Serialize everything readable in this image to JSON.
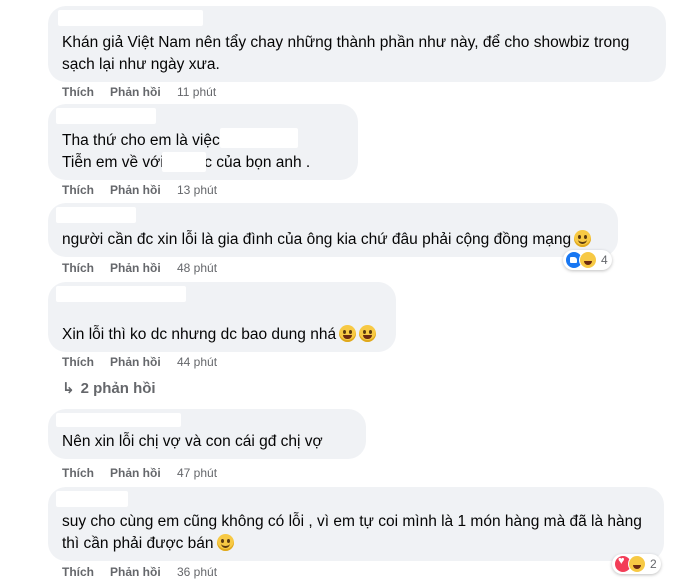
{
  "actions": {
    "like": "Thích",
    "reply": "Phản hồi"
  },
  "comments": [
    {
      "lines": [
        "Khán giả Việt Nam nên tẩy chay những thành phần như này, để cho showbiz trong",
        "sạch lại như ngày xưa."
      ],
      "time": "11 phút"
    },
    {
      "lines": [
        "Tha thứ cho em là việc",
        "Tiễn em về với            là việc của bọn anh ."
      ],
      "time": "13 phút"
    },
    {
      "lines": [
        "người cần đc xin lỗi là gia đình của ông kia chứ đâu phải cộng đồng mạng"
      ],
      "time": "48 phút",
      "emoji": "smile-icon",
      "reactions": {
        "icons": [
          "like",
          "haha"
        ],
        "count": "4"
      }
    },
    {
      "lines": [
        "Xin lỗi thì ko dc nhưng dc bao dung nhá"
      ],
      "time": "44 phút",
      "emoji": "laugh-icon"
    },
    {
      "lines": [
        "Nên xin lỗi chị vợ và con cái gđ chị vợ"
      ],
      "time": "47 phút"
    },
    {
      "lines": [
        "suy cho cùng em cũng không có lỗi , vì em tự coi mình là 1 món hàng mà đã là hàng",
        "thì cần phải được bán"
      ],
      "time": "36 phút",
      "emoji": "smile-icon",
      "reactions": {
        "icons": [
          "love",
          "haha"
        ],
        "count": "2"
      }
    }
  ],
  "view_replies": "2 phản hồi"
}
